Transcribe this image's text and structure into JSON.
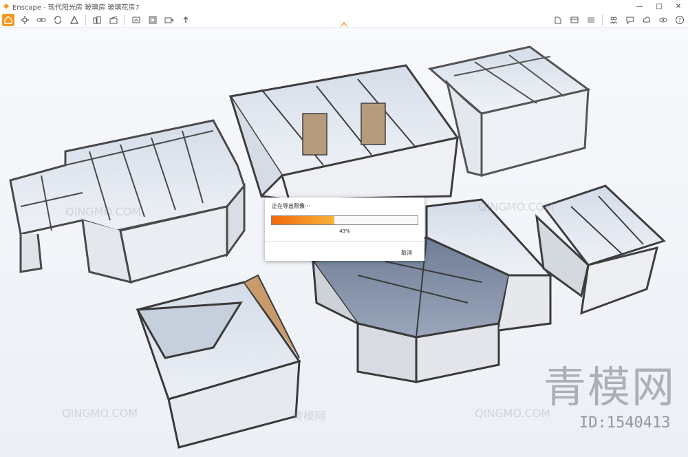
{
  "window": {
    "title": "Enscape - 现代阳光房 玻璃房 玻璃花房7",
    "controls": [
      "—",
      "□",
      "✕"
    ]
  },
  "toolbar": {
    "left_icons": [
      "home-icon",
      "settings-icon",
      "link-icon",
      "sync-icon",
      "camera-icon",
      "building-icon",
      "clapper-icon",
      "screenshot-icon",
      "batch-render-icon",
      "video-export-icon",
      "upload-icon"
    ],
    "right_icons": [
      "asset-library-icon",
      "material-editor-icon",
      "visual-settings-icon",
      "people-icon",
      "collaboration-icon",
      "cloud-icon",
      "view-icon",
      "help-icon"
    ]
  },
  "dialog": {
    "title": "正在导出照像···",
    "progress_percent": 43,
    "percent_label": "43%",
    "cancel_label": "取消"
  },
  "watermarks": {
    "site_text": "QINGMO.COM",
    "site_cn": "青模网",
    "brand": "青模网",
    "id": "ID:1540413"
  },
  "colors": {
    "accent": "#f39a1e",
    "progress_start": "#f06a0c",
    "progress_end": "#fab03a",
    "frame": "#4a4a4a"
  }
}
